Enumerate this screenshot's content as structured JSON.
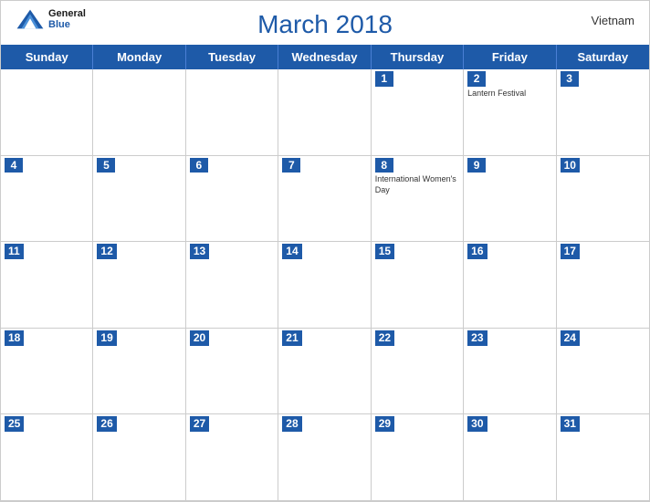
{
  "header": {
    "logo": {
      "general": "General",
      "blue": "Blue",
      "icon_title": "GeneralBlue logo"
    },
    "title": "March 2018",
    "country": "Vietnam"
  },
  "days_of_week": [
    "Sunday",
    "Monday",
    "Tuesday",
    "Wednesday",
    "Thursday",
    "Friday",
    "Saturday"
  ],
  "weeks": [
    [
      {
        "day": "",
        "empty": true
      },
      {
        "day": "",
        "empty": true
      },
      {
        "day": "",
        "empty": true
      },
      {
        "day": "",
        "empty": true
      },
      {
        "day": "1",
        "events": []
      },
      {
        "day": "2",
        "events": [
          "Lantern Festival"
        ]
      },
      {
        "day": "3",
        "events": []
      }
    ],
    [
      {
        "day": "4",
        "events": []
      },
      {
        "day": "5",
        "events": []
      },
      {
        "day": "6",
        "events": []
      },
      {
        "day": "7",
        "events": []
      },
      {
        "day": "8",
        "events": [
          "International Women's Day"
        ]
      },
      {
        "day": "9",
        "events": []
      },
      {
        "day": "10",
        "events": []
      }
    ],
    [
      {
        "day": "11",
        "events": []
      },
      {
        "day": "12",
        "events": []
      },
      {
        "day": "13",
        "events": []
      },
      {
        "day": "14",
        "events": []
      },
      {
        "day": "15",
        "events": []
      },
      {
        "day": "16",
        "events": []
      },
      {
        "day": "17",
        "events": []
      }
    ],
    [
      {
        "day": "18",
        "events": []
      },
      {
        "day": "19",
        "events": []
      },
      {
        "day": "20",
        "events": []
      },
      {
        "day": "21",
        "events": []
      },
      {
        "day": "22",
        "events": []
      },
      {
        "day": "23",
        "events": []
      },
      {
        "day": "24",
        "events": []
      }
    ],
    [
      {
        "day": "25",
        "events": []
      },
      {
        "day": "26",
        "events": []
      },
      {
        "day": "27",
        "events": []
      },
      {
        "day": "28",
        "events": []
      },
      {
        "day": "29",
        "events": []
      },
      {
        "day": "30",
        "events": []
      },
      {
        "day": "31",
        "events": []
      }
    ]
  ]
}
